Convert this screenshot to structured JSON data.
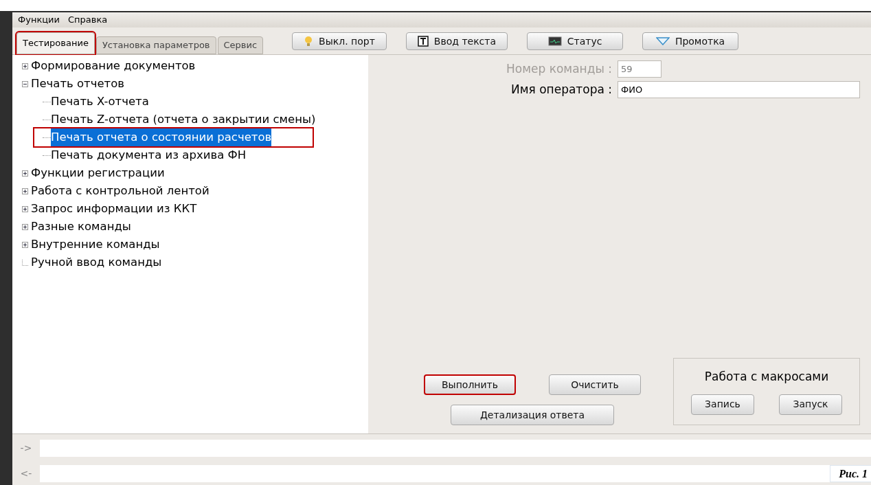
{
  "menu": [
    "Функции",
    "Справка"
  ],
  "tabs": [
    {
      "label": "Тестирование",
      "selected": true,
      "annotated": true
    },
    {
      "label": "Установка параметров",
      "selected": false,
      "annotated": false
    },
    {
      "label": "Сервис",
      "selected": false,
      "annotated": false
    }
  ],
  "toolbar": [
    {
      "label": "Выкл. порт",
      "kind": "bulb"
    },
    {
      "label": "Ввод текста",
      "kind": "text"
    },
    {
      "label": "Статус",
      "kind": "monitor"
    },
    {
      "label": "Промотка",
      "kind": "triangle"
    }
  ],
  "tree": [
    {
      "label": "Формирование документов",
      "expanded": false
    },
    {
      "label": "Печать отчетов",
      "expanded": true,
      "children": [
        {
          "label": "Печать X-отчета",
          "selected": false,
          "annotated": false
        },
        {
          "label": "Печать Z-отчета (отчета о закрытии смены)",
          "selected": false,
          "annotated": false
        },
        {
          "label": "Печать отчета о состоянии расчетов",
          "selected": true,
          "annotated": true
        },
        {
          "label": "Печать документа из архива ФН",
          "selected": false,
          "annotated": false
        }
      ]
    },
    {
      "label": "Функции регистрации",
      "expanded": false
    },
    {
      "label": "Работа с контрольной лентой",
      "expanded": false
    },
    {
      "label": "Запрос информации из ККТ",
      "expanded": false
    },
    {
      "label": "Разные команды",
      "expanded": false
    },
    {
      "label": "Внутренние команды",
      "expanded": false
    },
    {
      "label": "Ручной ввод команды",
      "leaf": true
    }
  ],
  "form": [
    {
      "label": "Номер команды :",
      "value": "59",
      "disabled": true
    },
    {
      "label": "Имя оператора :",
      "value": "ФИО",
      "disabled": false
    }
  ],
  "actions": [
    {
      "label": "Выполнить",
      "annotated": true
    },
    {
      "label": "Очистить",
      "annotated": false
    },
    {
      "label": "Детализация ответа",
      "annotated": false
    }
  ],
  "macros": {
    "title": "Работа с макросами",
    "buttons": [
      "Запись",
      "Запуск"
    ]
  },
  "io": [
    {
      "prompt": "->"
    },
    {
      "prompt": "<-"
    }
  ],
  "caption": "Рис. 1"
}
